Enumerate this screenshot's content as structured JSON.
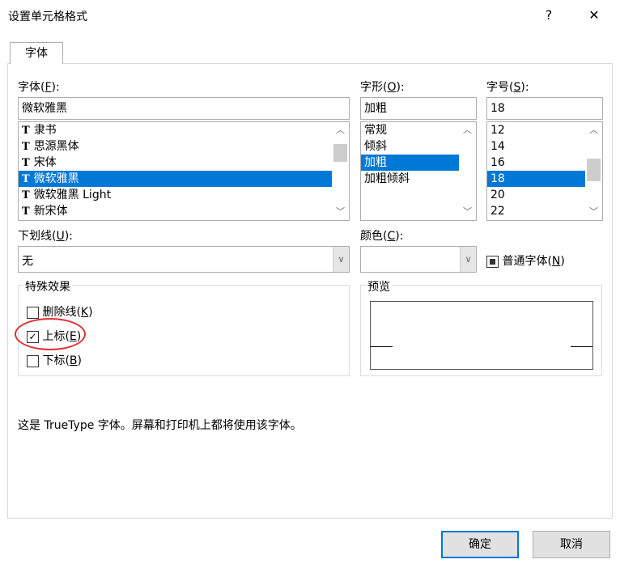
{
  "window": {
    "title": "设置单元格格式",
    "help": "?",
    "close": "✕"
  },
  "tabs": [
    {
      "label": "字体"
    }
  ],
  "font": {
    "label": "字体(",
    "key": "F",
    "end": "):",
    "value": "微软雅黑",
    "items": [
      "隶书",
      "思源黑体",
      "宋体",
      "微软雅黑",
      "微软雅黑 Light",
      "新宋体"
    ],
    "selected": 3
  },
  "style": {
    "label": "字形(",
    "key": "O",
    "end": "):",
    "value": "加粗",
    "items": [
      "常规",
      "倾斜",
      "加粗",
      "加粗倾斜"
    ],
    "selected": 2
  },
  "size": {
    "label": "字号(",
    "key": "S",
    "end": "):",
    "value": "18",
    "items": [
      "12",
      "14",
      "16",
      "18",
      "20",
      "22"
    ],
    "selected": 3
  },
  "underline": {
    "label": "下划线(",
    "key": "U",
    "end": "):",
    "value": "无"
  },
  "color": {
    "label": "颜色(",
    "key": "C",
    "end": "):",
    "value": ""
  },
  "normal_font": {
    "label": "普通字体(",
    "key": "N",
    "end": ")",
    "checked": "indeterminate"
  },
  "effects": {
    "title": "特殊效果",
    "items": [
      {
        "label": "删除线(",
        "key": "K",
        "end": ")",
        "checked": false
      },
      {
        "label": "上标(",
        "key": "E",
        "end": ")",
        "checked": true
      },
      {
        "label": "下标(",
        "key": "B",
        "end": ")",
        "checked": false
      }
    ]
  },
  "preview": {
    "title": "预览"
  },
  "info": "这是 TrueType 字体。屏幕和打印机上都将使用该字体。",
  "buttons": {
    "ok": "确定",
    "cancel": "取消"
  },
  "colors": {
    "accent": "#0078d7",
    "highlight": "#e03030"
  }
}
